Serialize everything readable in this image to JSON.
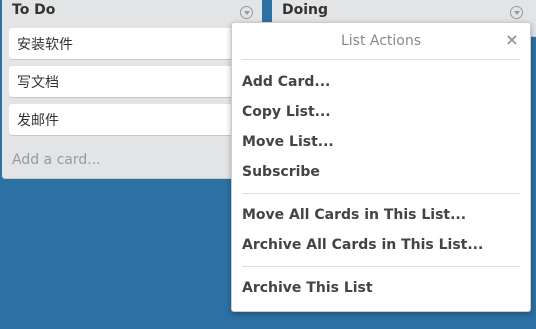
{
  "lists": {
    "todo": {
      "title": "To Do",
      "cards": [
        "安装软件",
        "写文档",
        "发邮件"
      ],
      "add_card_label": "Add a card..."
    },
    "doing": {
      "title": "Doing"
    }
  },
  "menu_icon": "chevron-down-circle-icon",
  "list_actions": {
    "title": "List Actions",
    "close_label": "×",
    "items": [
      "Add Card...",
      "Copy List...",
      "Move List...",
      "Subscribe",
      "Move All Cards in This List...",
      "Archive All Cards in This List...",
      "Archive This List"
    ]
  },
  "colors": {
    "board_background": "#2b71a3",
    "list_background": "#e2e4e6",
    "card_background": "#ffffff"
  }
}
